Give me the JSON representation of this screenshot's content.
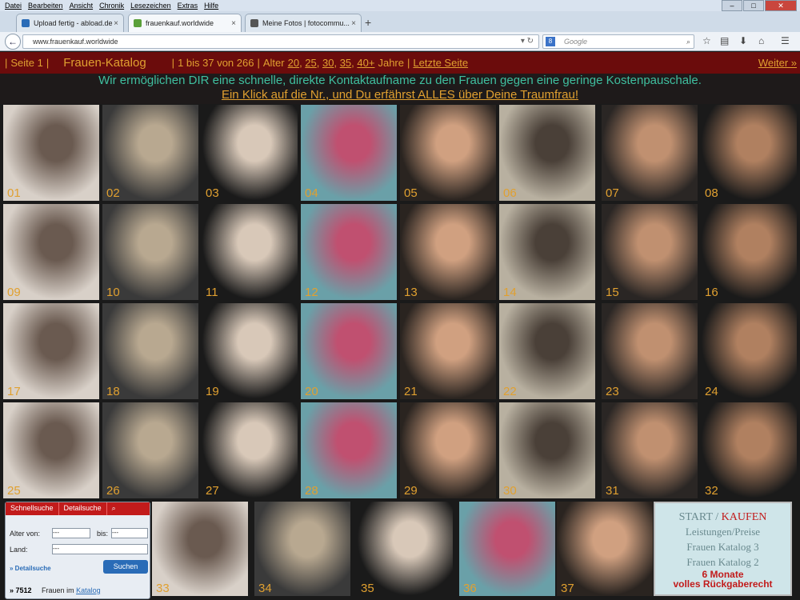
{
  "browser": {
    "menu": [
      "Datei",
      "Bearbeiten",
      "Ansicht",
      "Chronik",
      "Lesezeichen",
      "Extras",
      "Hilfe"
    ],
    "tabs": [
      {
        "label": "Upload fertig - abload.de",
        "color": "#2a6cb7"
      },
      {
        "label": "frauenkauf.worldwide",
        "color": "#5aa03a"
      },
      {
        "label": "Meine Fotos | fotocommu...",
        "color": "#555"
      }
    ],
    "url": "www.frauenkauf.worldwide",
    "search_placeholder": "Google"
  },
  "page": {
    "seite": "Seite 1",
    "katalog": "Frauen-Katalog",
    "range": "1 bis 37 von 266",
    "alter_label": "Alter",
    "ages": [
      "20",
      "25",
      "30",
      "35",
      "40+"
    ],
    "jahre": "Jahre",
    "letzte": "Letzte Seite",
    "weiter": "Weiter »",
    "tagline1": "Wir ermöglichen DIR eine schnelle, direkte Kontaktaufname zu den Frauen gegen eine geringe Kostenpauschale.",
    "tagline2": "Ein Klick auf die Nr., und Du erfährst ALLES über Deine Traumfrau!"
  },
  "photos": [
    "01",
    "02",
    "03",
    "04",
    "05",
    "06",
    "07",
    "08",
    "09",
    "10",
    "11",
    "12",
    "13",
    "14",
    "15",
    "16",
    "17",
    "18",
    "19",
    "20",
    "21",
    "22",
    "23",
    "24",
    "25",
    "26",
    "27",
    "28",
    "29",
    "30",
    "31",
    "32",
    "33",
    "34",
    "35",
    "36",
    "37"
  ],
  "search": {
    "tab1": "Schnellsuche",
    "tab2": "Detailsuche",
    "alter_von": "Alter von:",
    "bis": "bis:",
    "land": "Land:",
    "opt": "---",
    "detail_link": "» Detailsuche",
    "button": "Suchen",
    "count": "» 7512",
    "count_text": "Frauen im",
    "count_link": "Katalog"
  },
  "rmenu": {
    "start": "START",
    "sep": "/",
    "kaufen": "KAUFEN",
    "items": [
      "Leistungen/Preise",
      "Frauen Katalog 3",
      "Frauen Katalog 2"
    ],
    "guarantee1": "6 Monate",
    "guarantee2": "volles Rückgaberecht"
  }
}
